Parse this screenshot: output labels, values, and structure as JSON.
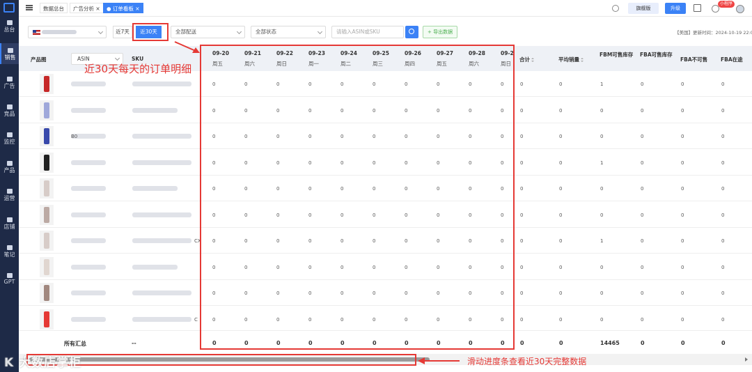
{
  "sidebar": {
    "items": [
      {
        "label": "总台"
      },
      {
        "label": "销售"
      },
      {
        "label": "广告"
      },
      {
        "label": "竞品"
      },
      {
        "label": "监控"
      },
      {
        "label": "产品"
      },
      {
        "label": "运营"
      },
      {
        "label": "店铺"
      },
      {
        "label": "笔记"
      },
      {
        "label": "GPT"
      }
    ]
  },
  "topbar": {
    "tabs": [
      "数据总台",
      "广告分析 ×",
      "● 订单看板 ×"
    ],
    "flagship_label": "旗舰版",
    "upgrade_label": "升级",
    "mini_program_badge": "小程序"
  },
  "filters": {
    "range_7": "近7天",
    "range_30": "近30天",
    "shipping": "全部配送",
    "status": "全部状态",
    "search_placeholder": "请输入ASIN或SKU",
    "export_label": "+ 导出数据",
    "update_time": "【美国】更新时间：2024-10-19 22:0"
  },
  "table": {
    "col_image": "产品图",
    "asin_select": "ASIN",
    "col_sku": "SKU",
    "dates": [
      {
        "date": "09-20",
        "weekday": "周五"
      },
      {
        "date": "09-21",
        "weekday": "周六"
      },
      {
        "date": "09-22",
        "weekday": "周日"
      },
      {
        "date": "09-23",
        "weekday": "周一"
      },
      {
        "date": "09-24",
        "weekday": "周二"
      },
      {
        "date": "09-25",
        "weekday": "周三"
      },
      {
        "date": "09-26",
        "weekday": "周四"
      },
      {
        "date": "09-27",
        "weekday": "周五"
      },
      {
        "date": "09-28",
        "weekday": "周六"
      },
      {
        "date": "09-2",
        "weekday": "周日"
      }
    ],
    "col_total": "合计",
    "col_avg": "平均销量",
    "col_fbm": "FBM可售库存",
    "col_fba": "FBA可售库存",
    "col_fba_unsellable": "FBA不可售",
    "col_fba_transit": "FBA在途",
    "rows": [
      {
        "asin_fragment": "",
        "sku_fragment": "",
        "color": "#c62828",
        "fbm": "1"
      },
      {
        "asin_fragment": "",
        "sku_fragment": "",
        "color": "#9fa8da",
        "fbm": "0"
      },
      {
        "asin_fragment": "B0",
        "sku_fragment": "",
        "color": "#3949ab",
        "fbm": "0"
      },
      {
        "asin_fragment": "",
        "sku_fragment": "",
        "color": "#212121",
        "fbm": "1"
      },
      {
        "asin_fragment": "",
        "sku_fragment": "",
        "color": "#d7ccc8",
        "fbm": "0"
      },
      {
        "asin_fragment": "",
        "sku_fragment": "",
        "color": "#bcaaa4",
        "fbm": "0"
      },
      {
        "asin_fragment": "",
        "sku_fragment": "CX",
        "color": "#d7ccc8",
        "fbm": "1"
      },
      {
        "asin_fragment": "",
        "sku_fragment": "",
        "color": "#e0d6d0",
        "fbm": "0"
      },
      {
        "asin_fragment": "",
        "sku_fragment": "",
        "color": "#a1887f",
        "fbm": "0"
      },
      {
        "asin_fragment": "",
        "sku_fragment": "C",
        "color": "#e53935",
        "fbm": "0"
      }
    ],
    "zero": "0"
  },
  "summary": {
    "label": "所有汇总",
    "sku": "--",
    "zero": "0",
    "fbm_total": "14465"
  },
  "annotations": {
    "orders_detail": "近30天每天的订单明细",
    "scroll_hint": "滑动进度条查看近30天完整数据",
    "watermark": "K 大数店掌柜"
  }
}
